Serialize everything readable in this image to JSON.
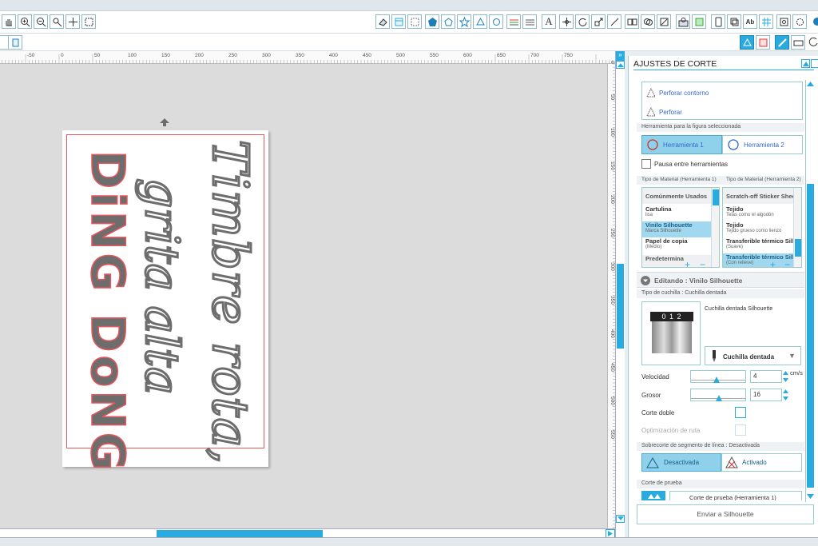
{
  "panel": {
    "title": "AJUSTES DE CORTE",
    "perforar_contorno": "Perforar contorno",
    "perforar": "Perforar",
    "tool_section_label": "Herramienta para la figura seleccionada",
    "tool1": "Herramienta 1",
    "tool2": "Herramienta 2",
    "pause_label": "Pausa entre herramientas",
    "material_label_1": "Tipo de Material (Herramienta 1)",
    "material_label_2": "Tipo de Material (Herramienta 2)",
    "materials_1": [
      {
        "name": "Comúnmente Usados",
        "sub": ""
      },
      {
        "name": "Cartulina",
        "sub": "lisa"
      },
      {
        "name": "Vinilo Silhouette",
        "sub": "Marca Silhouette"
      },
      {
        "name": "Papel de copia",
        "sub": "(Medio)"
      },
      {
        "name": "Predetermina",
        "sub": ""
      }
    ],
    "materials_2": [
      {
        "name": "Scratch-off Sticker Sheet",
        "sub": ""
      },
      {
        "name": "Tejido",
        "sub": "Telas como el algodón"
      },
      {
        "name": "Tejido",
        "sub": "Tejido grueso como lienzo"
      },
      {
        "name": "Transferible térmico Silh",
        "sub": "(Suave)"
      },
      {
        "name": "Transferible térmico Silh",
        "sub": "(Con relieve)"
      }
    ],
    "editing_label": "Editando : Vinilo Silhouette",
    "blade_section_label": "Tipo de cuchilla : Cuchilla dentada",
    "blade_name": "Cuchilla dentada Silhouette",
    "blade_digits": "0 1 2",
    "blade_select": "Cuchilla dentada",
    "speed_label": "Velocidad",
    "speed_value": "4",
    "speed_unit": "cm/s",
    "speed_level": 0.45,
    "thickness_label": "Grosor",
    "thickness_value": "16",
    "thickness_level": 0.5,
    "double_cut": "Corte doble",
    "path_opt": "Optimización de ruta",
    "overcut_label": "Sobrecorte de segmento de línea : Desactivada",
    "overcut_off": "Desactivada",
    "overcut_on": "Activado",
    "test_cut_label": "Corte de prueba",
    "test_cut_btn": "Corte de prueba (Herramienta 1)",
    "send_button": "Enviar a Silhouette"
  },
  "ruler": {
    "h_labels": [
      "-50",
      "0",
      "50",
      "100",
      "150",
      "200",
      "250",
      "300",
      "350",
      "400",
      "450",
      "500",
      "550",
      "600",
      "650",
      "700",
      "750"
    ],
    "v_labels": [
      "0",
      "50",
      "100",
      "150",
      "200",
      "250",
      "300",
      "350",
      "400",
      "450",
      "500",
      "550"
    ]
  },
  "canvas": {
    "line1": "Timbre rota,",
    "line2": "grita alta",
    "line3": "DiNG DoNG"
  },
  "colors": {
    "accent": "#29abe0",
    "shape_fill": "#6d6d6d",
    "cut_line": "#e8555a"
  }
}
